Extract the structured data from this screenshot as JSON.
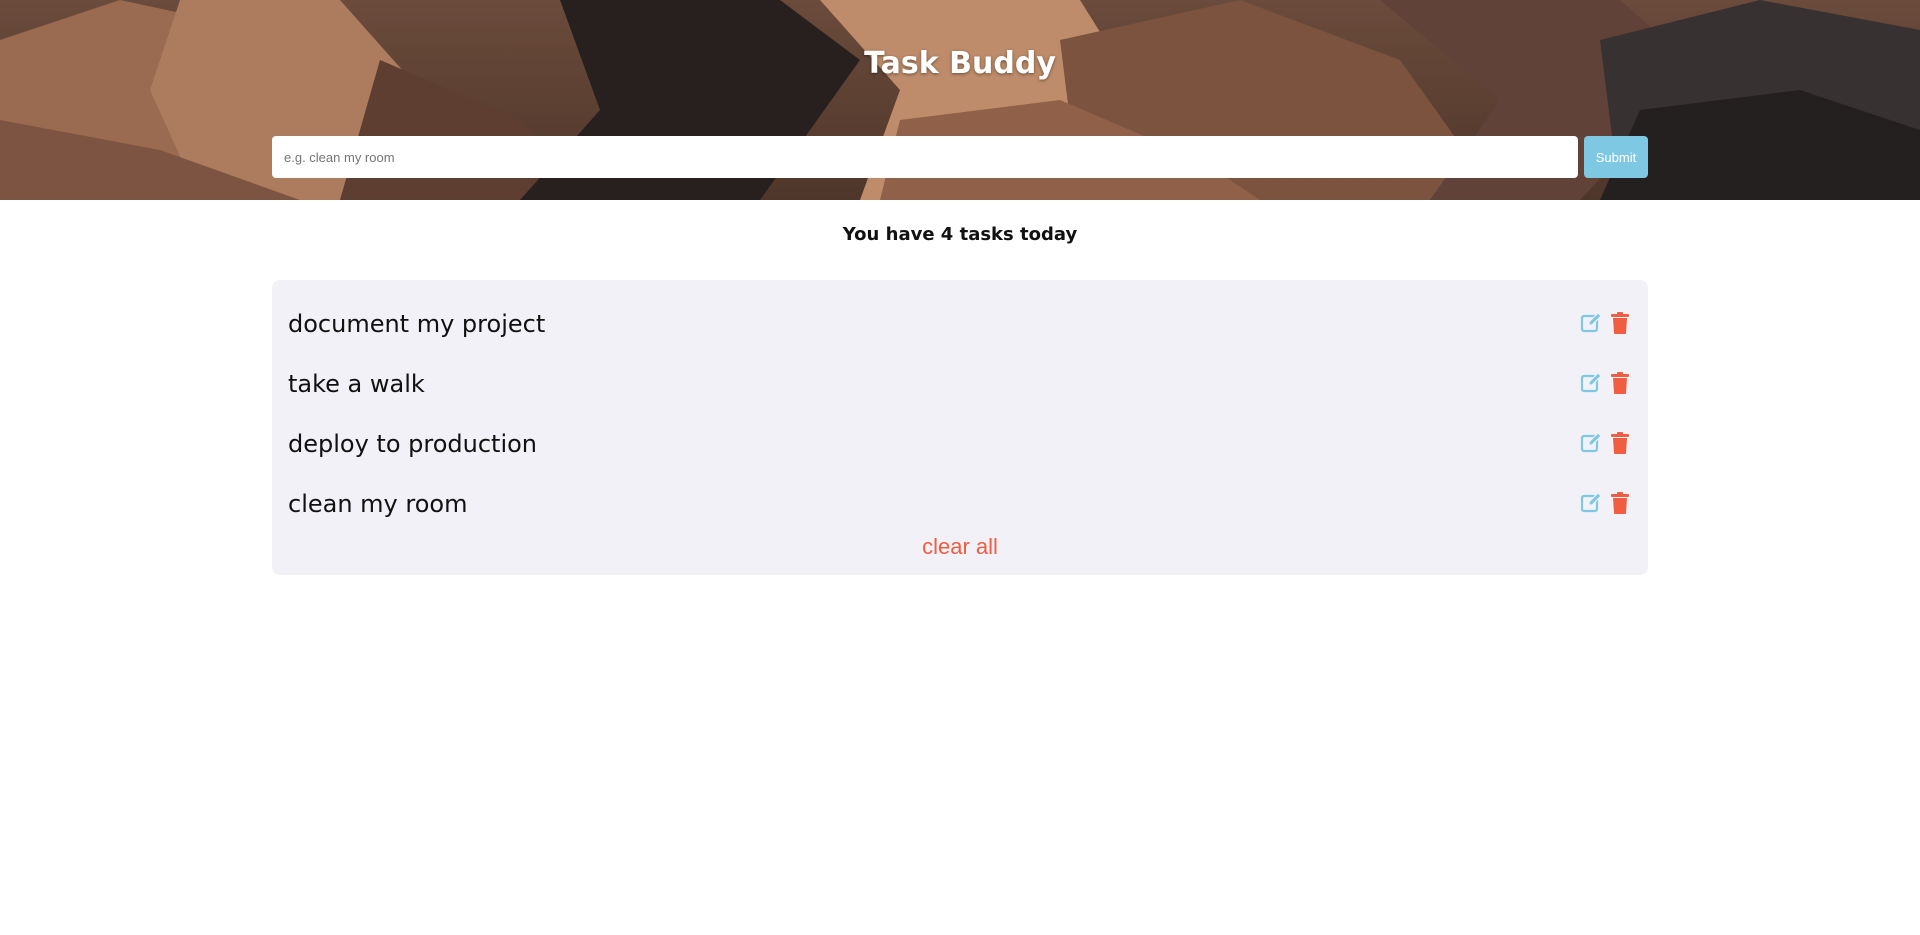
{
  "app": {
    "title": "Task Buddy"
  },
  "form": {
    "placeholder": "e.g. clean my room",
    "value": "",
    "submit_label": "Submit"
  },
  "summary": {
    "text": "You have 4 tasks today"
  },
  "tasks": [
    {
      "label": "document my project"
    },
    {
      "label": "take a walk"
    },
    {
      "label": "deploy to production"
    },
    {
      "label": "clean my room"
    }
  ],
  "actions": {
    "clear_all_label": "clear all"
  },
  "icons": {
    "edit": "edit-icon",
    "delete": "trash-icon"
  },
  "colors": {
    "accent_blue": "#7ec8e3",
    "danger_red": "#f05d40",
    "panel_bg": "#f2f1f7"
  }
}
